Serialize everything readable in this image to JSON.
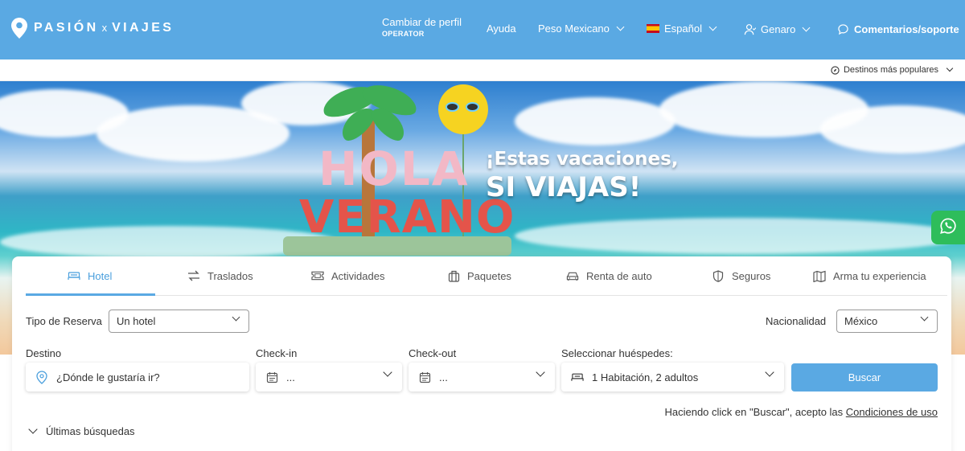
{
  "header": {
    "brand_left": "PASIÓN",
    "brand_x": "x",
    "brand_right": "VIAJES",
    "profile_label": "Cambiar de perfil",
    "profile_role": "OPERATOR",
    "help": "Ayuda",
    "currency": "Peso Mexicano",
    "language": "Español",
    "user": "Genaro",
    "feedback": "Comentarios/soporte",
    "color": "#5aa9e3"
  },
  "subbar": {
    "popular": "Destinos más populares"
  },
  "banner": {
    "hola": "HOLA",
    "verano": "VERANO",
    "slogan_line1": "¡Estas vacaciones,",
    "slogan_line2": "SI VIAJAS!"
  },
  "tabs": [
    {
      "label": "Hotel",
      "icon": "bed-icon",
      "active": true
    },
    {
      "label": "Traslados",
      "icon": "transfer-arrows-icon"
    },
    {
      "label": "Actividades",
      "icon": "ticket-icon"
    },
    {
      "label": "Paquetes",
      "icon": "suitcase-icon"
    },
    {
      "label": "Renta de auto",
      "icon": "car-icon"
    },
    {
      "label": "Seguros",
      "icon": "shield-icon"
    },
    {
      "label": "Arma tu experiencia",
      "icon": "map-icon"
    }
  ],
  "form": {
    "booking_type_label": "Tipo de Reserva",
    "booking_type_value": "Un hotel",
    "nationality_label": "Nacionalidad",
    "nationality_value": "México",
    "destination_label": "Destino",
    "destination_placeholder": "¿Dónde le gustaría ir?",
    "checkin_label": "Check-in",
    "checkin_value": "...",
    "checkout_label": "Check-out",
    "checkout_value": "...",
    "guests_label": "Seleccionar huéspedes:",
    "guests_value": "1 Habitación, 2 adultos",
    "search_button": "Buscar",
    "terms_text": "Haciendo click en \"Buscar\", acepto las",
    "terms_link": "Condiciones de uso",
    "recent_searches": "Últimas búsquedas"
  }
}
